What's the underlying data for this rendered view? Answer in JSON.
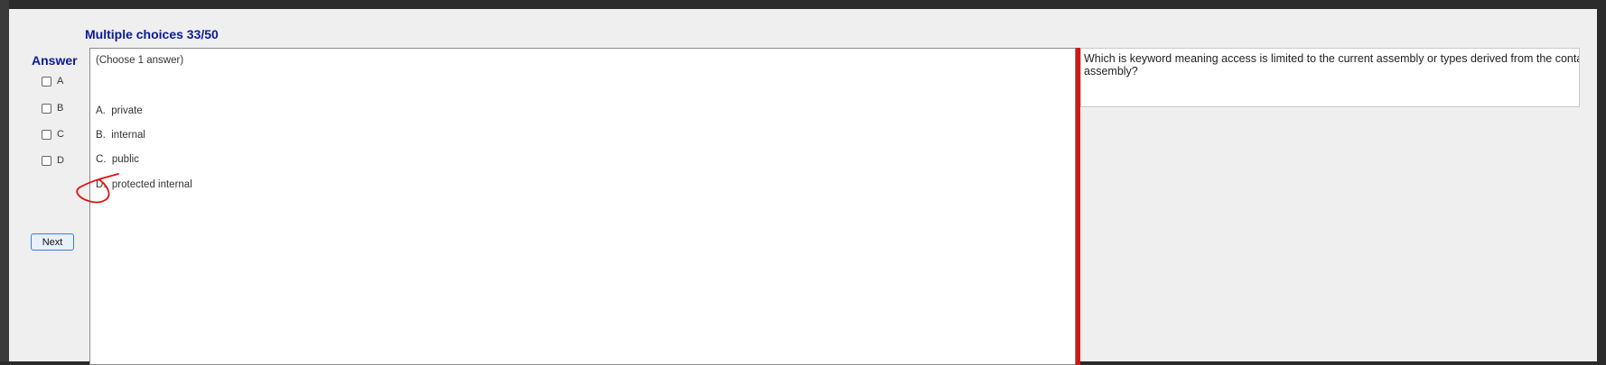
{
  "app": {
    "title": "Multiple choices 33/50",
    "answer_heading": "Answer"
  },
  "answer_choices": [
    {
      "label": "A",
      "checked": false
    },
    {
      "label": "B",
      "checked": false
    },
    {
      "label": "C",
      "checked": false
    },
    {
      "label": "D",
      "checked": false
    }
  ],
  "next_button_label": "Next",
  "options_panel": {
    "instruction": "(Choose 1 answer)",
    "options": [
      {
        "text": "A.  private"
      },
      {
        "text": "B.  internal"
      },
      {
        "text": "C.  public"
      },
      {
        "text": "D.  protected internal"
      }
    ]
  },
  "question": {
    "text": "Which is keyword meaning access is limited to the current assembly or types derived from the containing class in the current assembly?"
  },
  "colors": {
    "title": "#0a1a9a",
    "divider": "#d01818",
    "annotation": "#e01010"
  }
}
